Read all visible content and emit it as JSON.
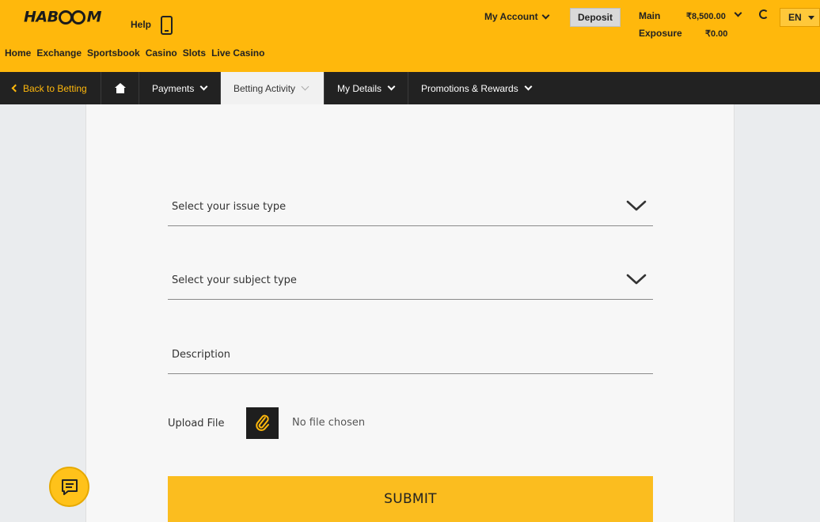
{
  "header": {
    "logo_text": "HAB",
    "logo_tail": "M",
    "help_label": "Help",
    "nav": [
      "Home",
      "Exchange",
      "Sportsbook",
      "Casino",
      "Slots",
      "Live Casino"
    ],
    "my_account_label": "My Account",
    "deposit_label": "Deposit",
    "main_label": "Main",
    "main_value": "₹8,500.00",
    "exposure_label": "Exposure",
    "exposure_value": "₹0.00",
    "language": "EN"
  },
  "subnav": {
    "back_label": "Back to Betting",
    "payments_label": "Payments",
    "betting_activity_label": "Betting Activity",
    "my_details_label": "My Details",
    "promotions_label": "Promotions & Rewards"
  },
  "form": {
    "issue_type_placeholder": "Select your issue type",
    "subject_type_placeholder": "Select your subject type",
    "description_placeholder": "Description",
    "upload_label": "Upload File",
    "no_file_text": "No file chosen",
    "submit_label": "SUBMIT"
  },
  "colors": {
    "brand_yellow": "#ffb80c",
    "dark_nav": "#222222",
    "submit_yellow": "#fbbd1f"
  },
  "icons": [
    "phone-icon",
    "chevron-down-icon",
    "refresh-icon",
    "caret-down-icon",
    "chevron-left-icon",
    "home-icon",
    "paperclip-icon",
    "chat-icon"
  ]
}
